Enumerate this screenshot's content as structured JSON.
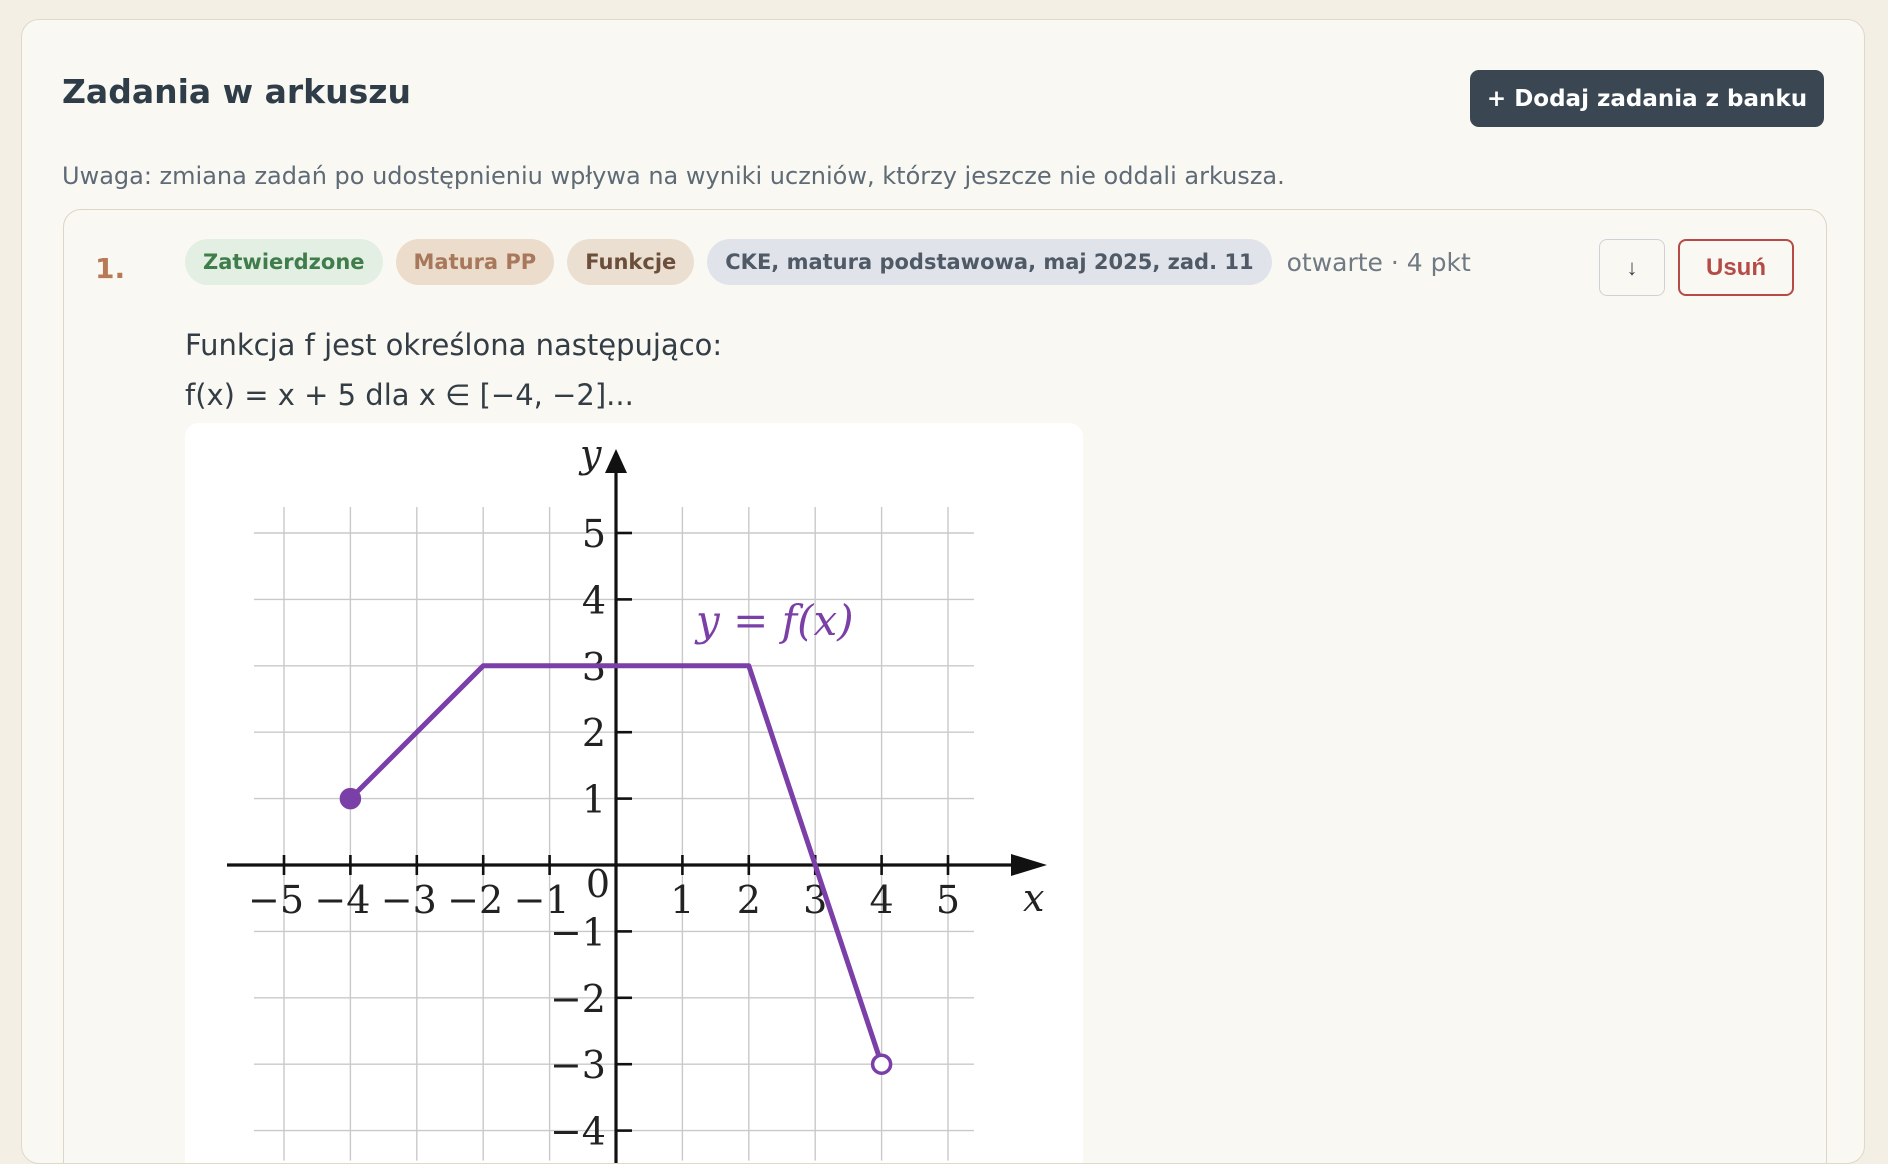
{
  "header": {
    "title": "Zadania w arkuszu",
    "add_button_label": "+ Dodaj zadania z banku"
  },
  "note": "Uwaga: zmiana zadań po udostępnieniu wpływa na wyniki uczniów, którzy jeszcze nie oddali arkusza.",
  "task": {
    "number": "1.",
    "tags": {
      "status": "Zatwierdzone",
      "exam": "Matura PP",
      "topic": "Funkcje",
      "source": "CKE, matura podstawowa, maj 2025, zad. 11"
    },
    "meta": "otwarte · 4 pkt",
    "move_down_label": "↓",
    "delete_label": "Usuń",
    "question_line1": "Funkcja f jest określona następująco:",
    "question_line2": "f(x) = x + 5 dla x ∈ [−4, −2]..."
  },
  "colors": {
    "accent_dark": "#3a4753",
    "function_purple": "#7b3fa8",
    "danger": "#b54a47"
  },
  "chart_data": {
    "type": "line",
    "xlabel": "x",
    "ylabel": "y",
    "function_label": "y = f(x)",
    "x_ticks": [
      "−5",
      "−4",
      "−3",
      "−2",
      "−1",
      "1",
      "2",
      "3",
      "4",
      "5"
    ],
    "y_ticks": [
      "5",
      "4",
      "3",
      "2",
      "1",
      "−1",
      "−2",
      "−3",
      "−4"
    ],
    "origin_label": "0",
    "xlim": [
      -5,
      5
    ],
    "ylim": [
      -4,
      5
    ],
    "grid": true,
    "series": [
      {
        "x": [
          -4,
          -2,
          2,
          4
        ],
        "y": [
          1,
          3,
          3,
          -3
        ]
      }
    ],
    "endpoints": [
      {
        "x": -4,
        "y": 1,
        "filled": true
      },
      {
        "x": 4,
        "y": -3,
        "filled": false
      }
    ]
  }
}
